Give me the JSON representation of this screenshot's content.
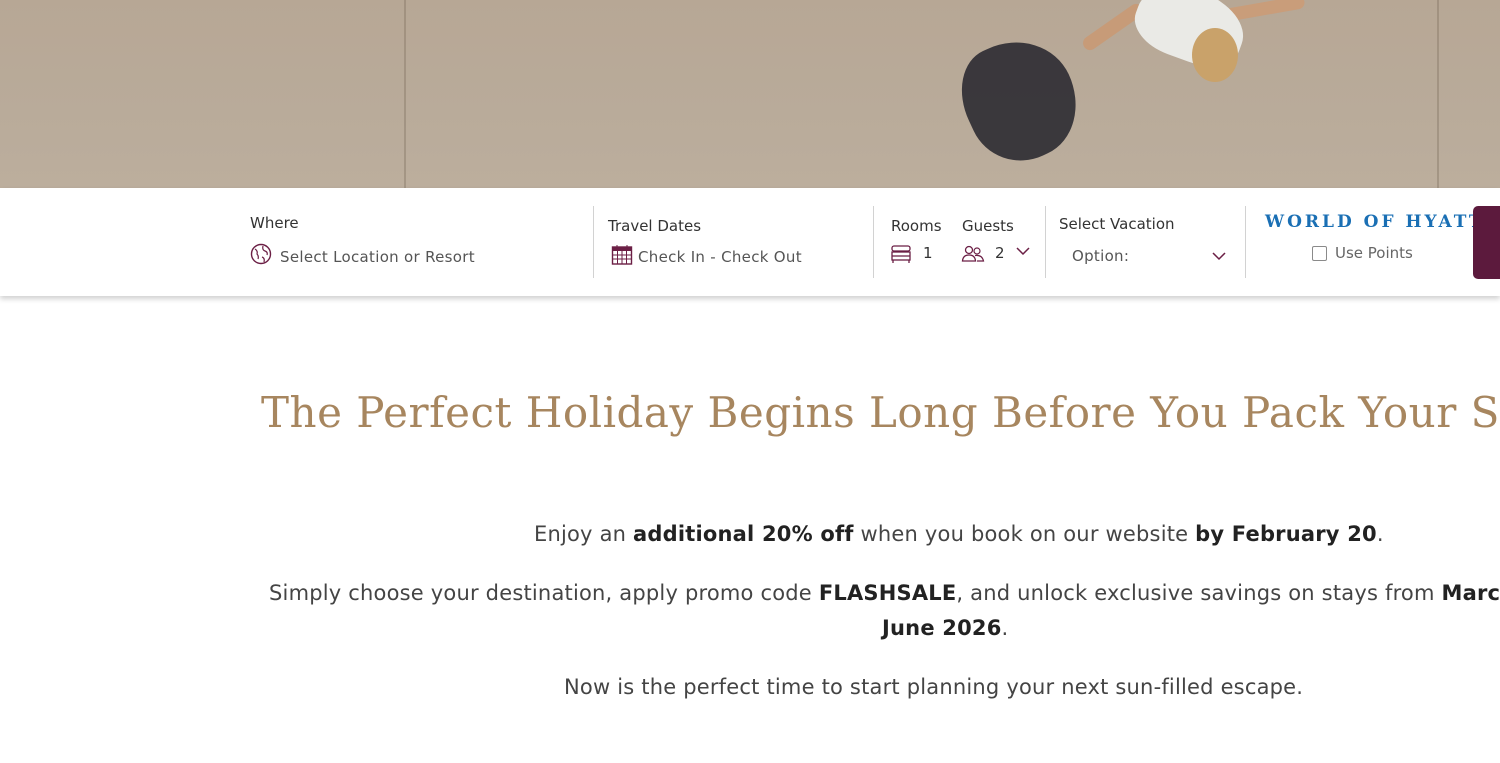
{
  "booking": {
    "where": {
      "label": "Where",
      "placeholder": "Select Location or Resort"
    },
    "travel_dates": {
      "label": "Travel Dates",
      "placeholder": "Check In - Check Out"
    },
    "rooms": {
      "label": "Rooms",
      "value": "1"
    },
    "guests": {
      "label": "Guests",
      "value": "2"
    },
    "vacation": {
      "label": "Select Vacation",
      "value": "Option:"
    },
    "loyalty": {
      "logo_text": "WORLD OF HYATT",
      "logo_mark": "®",
      "use_points_label": "Use Points",
      "use_points_checked": false
    }
  },
  "content": {
    "headline": "The Perfect Holiday Begins Long Before You Pack Your Su",
    "offer": {
      "p1": "Enjoy an ",
      "b1": "additional 20% off",
      "p2": " when you book on our website ",
      "b2": "by February 20",
      "p3": "."
    },
    "promo": {
      "p1": "Simply choose your destination, apply promo code ",
      "b1": "FLASHSALE",
      "p2": ", and unlock exclusive savings on stays from ",
      "b2": "Marc",
      "b3": "June 2026",
      "p3": "."
    },
    "closing": "Now is the perfect time to start planning your next sun-filled escape."
  },
  "colors": {
    "brand_plum": "#5c1a3d",
    "headline_gold": "#a7865f",
    "hyatt_blue": "#1a6fb4",
    "icon_plum": "#6b1f45"
  },
  "icons": {
    "where": "globe-icon",
    "dates": "calendar-icon",
    "rooms": "bed-icon",
    "guests": "guests-icon",
    "dropdown": "chevron-down-icon"
  }
}
